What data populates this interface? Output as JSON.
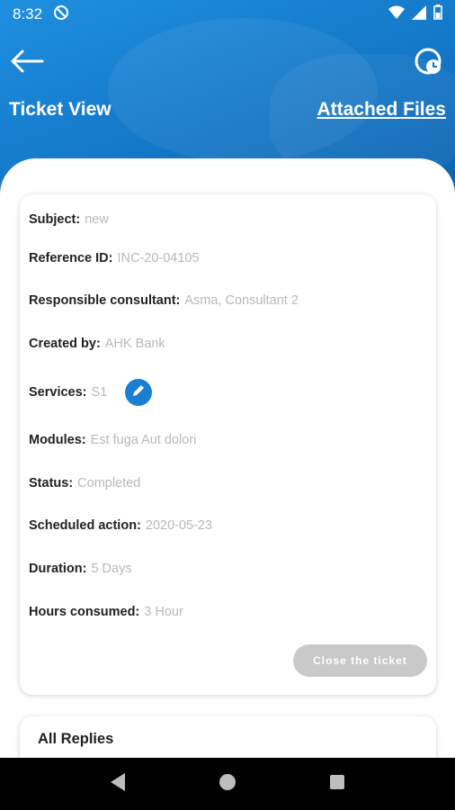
{
  "status_bar": {
    "time": "8:32",
    "icons": [
      "do-not-disturb-icon",
      "wifi-icon",
      "signal-icon",
      "battery-icon"
    ]
  },
  "header": {
    "title": "Ticket View",
    "attached_files": "Attached Files",
    "back_icon": "back-arrow-icon",
    "history_icon": "history-icon"
  },
  "ticket": {
    "subject": {
      "label": "Subject:",
      "value": "new"
    },
    "reference_id": {
      "label": "Reference ID:",
      "value": "INC-20-04105"
    },
    "consultant": {
      "label": "Responsible consultant:",
      "value": "Asma, Consultant 2"
    },
    "created_by": {
      "label": "Created by:",
      "value": "AHK Bank"
    },
    "services": {
      "label": "Services:",
      "value": "S1"
    },
    "modules": {
      "label": "Modules:",
      "value": "Est fuga Aut dolori"
    },
    "status": {
      "label": "Status:",
      "value": "Completed"
    },
    "scheduled": {
      "label": "Scheduled action:",
      "value": "2020-05-23"
    },
    "duration": {
      "label": "Duration:",
      "value": "5 Days"
    },
    "hours": {
      "label": "Hours consumed:",
      "value": "3 Hour"
    },
    "close_button": "Close the ticket"
  },
  "replies": {
    "title": "All Replies"
  },
  "colors": {
    "header_blue": "#1478c8",
    "accent": "#1a7fd3",
    "muted_value": "#b9b9b9",
    "disabled_button": "#c9c9c9"
  }
}
